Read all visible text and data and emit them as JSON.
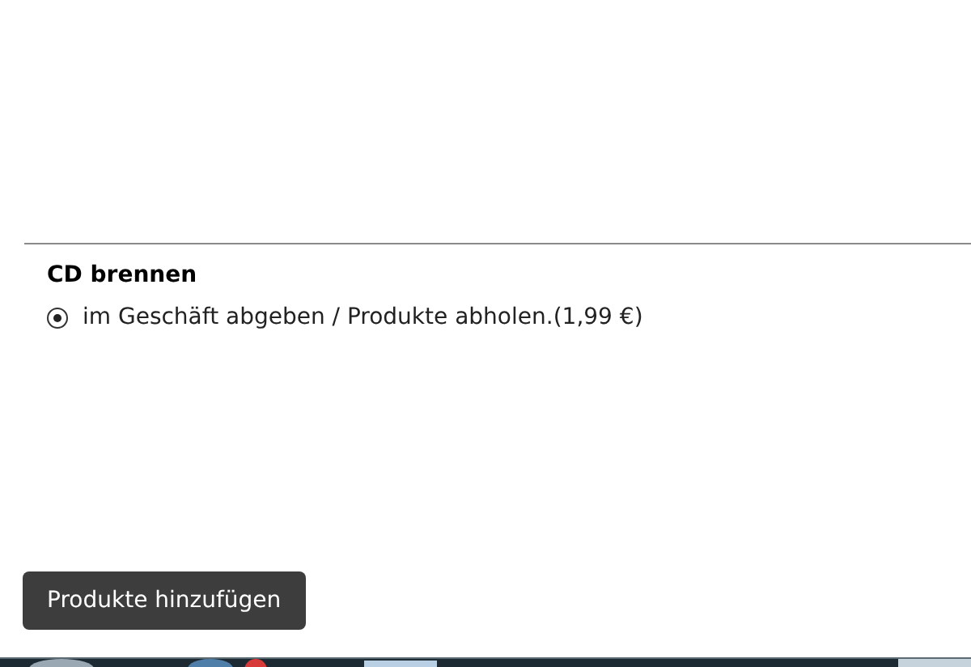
{
  "section": {
    "title": "CD brennen",
    "options": [
      {
        "label": "im Geschäft abgeben / Produkte abholen.(1,99 €)",
        "selected": true
      }
    ]
  },
  "add_button": {
    "label": "Produkte hinzufügen"
  }
}
